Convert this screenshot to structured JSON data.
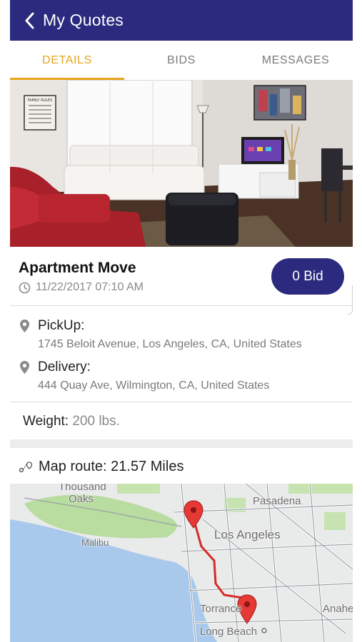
{
  "header": {
    "title": "My Quotes",
    "back_icon": "chevron-left-icon"
  },
  "tabs": [
    {
      "label": "DETAILS",
      "active": true
    },
    {
      "label": "BIDS",
      "active": false
    },
    {
      "label": "MESSAGES",
      "active": false
    }
  ],
  "quote": {
    "title": "Apartment Move",
    "datetime": "11/22/2017 07:10 AM",
    "bid_label": "0 Bid"
  },
  "pickup": {
    "label": "PickUp:",
    "address": "1745 Beloit Avenue, Los Angeles, CA, United States"
  },
  "delivery": {
    "label": "Delivery:",
    "address": "444 Quay Ave, Wilmington, CA, United States"
  },
  "weight": {
    "label": "Weight:",
    "value": "200 lbs."
  },
  "route": {
    "label": "Map route: 21.57 Miles"
  },
  "map": {
    "labels": {
      "thousand": "Thousand",
      "oaks": "Oaks",
      "pasadena": "Pasadena",
      "los_angeles": "Los Angeles",
      "malibu": "Malibu",
      "torrance": "Torrance",
      "anaheim": "Anahe",
      "long_beach": "Long Beach"
    }
  },
  "photo": {
    "poster_text": "FAMILY RULES"
  },
  "colors": {
    "primary": "#2b2a7f",
    "accent": "#e6a51a",
    "route": "#d62a2a"
  }
}
